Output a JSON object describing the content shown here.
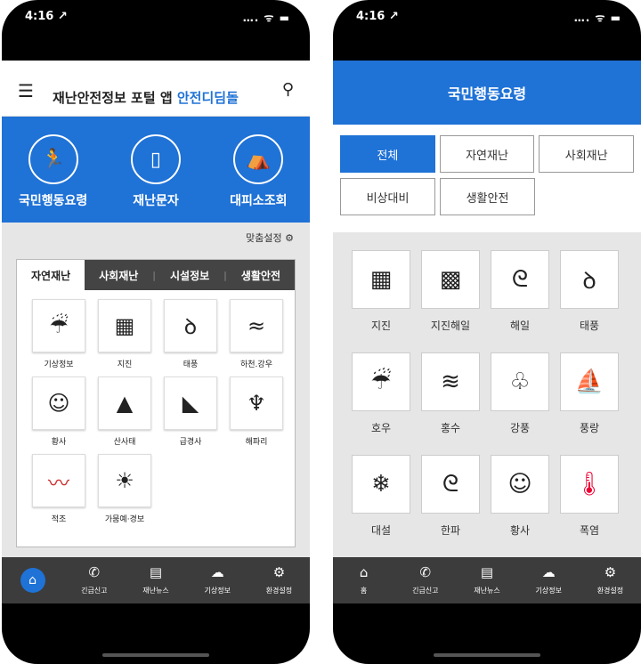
{
  "left": {
    "status": {
      "time": "4:16 ↗",
      "signal": "…. ᯤ ▬"
    },
    "header": {
      "title": "재난안전정보 포털 앱 ",
      "title_accent": "안전디딤돌"
    },
    "shortcuts": [
      {
        "label": "국민행동요령",
        "icon": "running-person-icon",
        "glyph": "🏃"
      },
      {
        "label": "재난문자",
        "icon": "smartphone-icon",
        "glyph": "▯"
      },
      {
        "label": "대피소조회",
        "icon": "shelter-icon",
        "glyph": "⛺"
      }
    ],
    "custom_label": "맞춤설정 ⚙",
    "tabs": [
      "자연재난",
      "사회재난",
      "시설정보",
      "생활안전"
    ],
    "items": [
      {
        "label": "기상정보",
        "icon": "weather-icon",
        "glyph": "☔"
      },
      {
        "label": "지진",
        "icon": "earthquake-icon",
        "glyph": "▦"
      },
      {
        "label": "태풍",
        "icon": "typhoon-icon",
        "glyph": "ꝺ"
      },
      {
        "label": "하천.강우",
        "icon": "river-icon",
        "glyph": "≈"
      },
      {
        "label": "황사",
        "icon": "dust-mask-icon",
        "glyph": "☺"
      },
      {
        "label": "산사태",
        "icon": "landslide-icon",
        "glyph": "▲"
      },
      {
        "label": "급경사",
        "icon": "steep-slope-icon",
        "glyph": "◣"
      },
      {
        "label": "해파리",
        "icon": "jellyfish-icon",
        "glyph": "♆"
      },
      {
        "label": "적조",
        "icon": "red-tide-icon",
        "glyph": "〰"
      },
      {
        "label": "가뭄예·경보",
        "icon": "drought-icon",
        "glyph": "☀"
      }
    ],
    "tabbar": [
      {
        "label": "",
        "icon": "home-icon",
        "glyph": "⌂"
      },
      {
        "label": "긴급신고",
        "icon": "phone-icon",
        "glyph": "✆"
      },
      {
        "label": "재난뉴스",
        "icon": "news-icon",
        "glyph": "▤"
      },
      {
        "label": "기상정보",
        "icon": "weather-icon",
        "glyph": "☁"
      },
      {
        "label": "환경설정",
        "icon": "gear-icon",
        "glyph": "⚙"
      }
    ]
  },
  "right": {
    "status": {
      "time": "4:16 ↗",
      "signal": "…. ᯤ ▬"
    },
    "title": "국민행동요령",
    "categories": [
      "전체",
      "자연재난",
      "사회재난",
      "비상대비",
      "생활안전"
    ],
    "items": [
      {
        "label": "지진",
        "icon": "earthquake-icon",
        "glyph": "▦"
      },
      {
        "label": "지진해일",
        "icon": "tsunami-icon",
        "glyph": "▩"
      },
      {
        "label": "해일",
        "icon": "wave-icon",
        "glyph": "ᘓ"
      },
      {
        "label": "태풍",
        "icon": "typhoon-icon",
        "glyph": "ꝺ"
      },
      {
        "label": "호우",
        "icon": "heavy-rain-icon",
        "glyph": "☔"
      },
      {
        "label": "홍수",
        "icon": "flood-icon",
        "glyph": "≋"
      },
      {
        "label": "강풍",
        "icon": "strong-wind-icon",
        "glyph": "♧"
      },
      {
        "label": "풍랑",
        "icon": "high-waves-icon",
        "glyph": "⛵"
      },
      {
        "label": "대설",
        "icon": "heavy-snow-icon",
        "glyph": "❄"
      },
      {
        "label": "한파",
        "icon": "cold-wave-icon",
        "glyph": "ᘓ"
      },
      {
        "label": "황사",
        "icon": "dust-mask-icon",
        "glyph": "☺"
      },
      {
        "label": "폭염",
        "icon": "thermometer-icon",
        "glyph": "🌡"
      }
    ],
    "tabbar": [
      {
        "label": "홈",
        "icon": "home-icon",
        "glyph": "⌂"
      },
      {
        "label": "긴급신고",
        "icon": "phone-icon",
        "glyph": "✆"
      },
      {
        "label": "재난뉴스",
        "icon": "news-icon",
        "glyph": "▤"
      },
      {
        "label": "기상정보",
        "icon": "weather-icon",
        "glyph": "☁"
      },
      {
        "label": "환경설정",
        "icon": "gear-icon",
        "glyph": "⚙"
      }
    ]
  }
}
